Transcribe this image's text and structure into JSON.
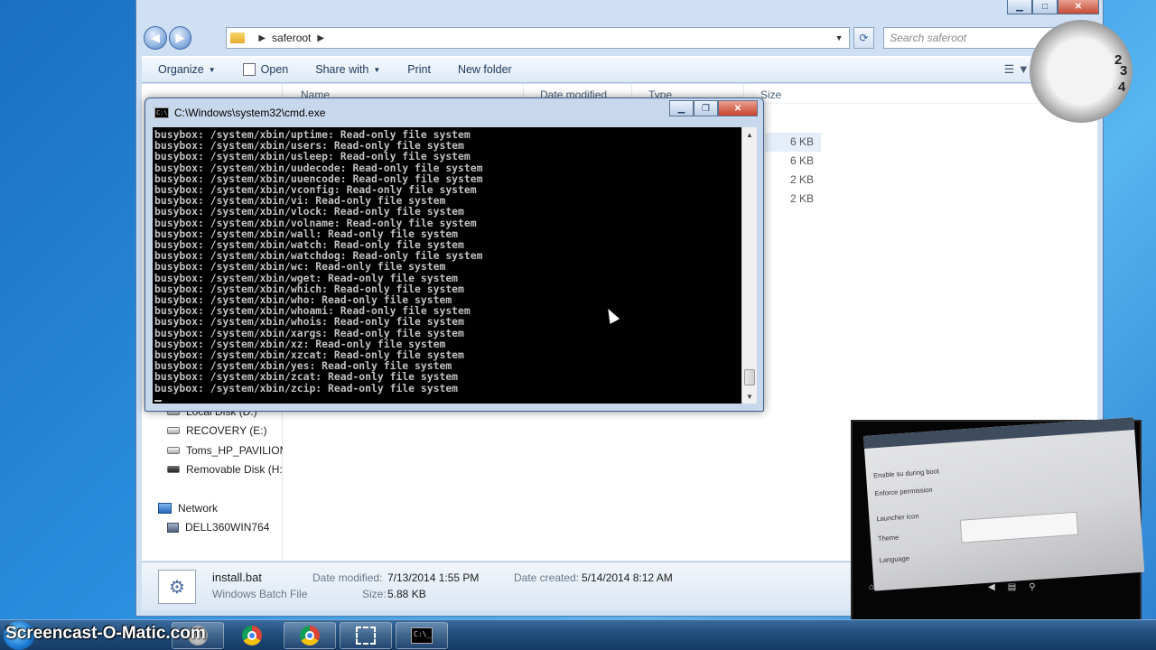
{
  "explorer": {
    "breadcrumb": [
      "saferoot"
    ],
    "search_placeholder": "Search saferoot",
    "toolbar": {
      "organize": "Organize",
      "open": "Open",
      "share_with": "Share with",
      "print": "Print",
      "new_folder": "New folder"
    },
    "columns": {
      "name": "Name",
      "date_modified": "Date modified",
      "type": "Type",
      "size": "Size"
    },
    "file_sizes": [
      "6 KB",
      "6 KB",
      "2 KB",
      "2 KB"
    ],
    "nav_tree": [
      {
        "label": "Local Disk (D:)",
        "icon": "drive-icon"
      },
      {
        "label": "RECOVERY (E:)",
        "icon": "drive-icon"
      },
      {
        "label": "Toms_HP_PAVILION",
        "icon": "drive-icon"
      },
      {
        "label": "Removable Disk (H:)",
        "icon": "removable-disk-icon"
      }
    ],
    "network": {
      "label": "Network",
      "computer": "DELL360WIN764"
    },
    "details": {
      "filename": "install.bat",
      "filetype": "Windows Batch File",
      "date_modified_label": "Date modified:",
      "date_modified": "7/13/2014 1:55 PM",
      "size_label": "Size:",
      "size": "5.88 KB",
      "date_created_label": "Date created:",
      "date_created": "5/14/2014 8:12 AM"
    }
  },
  "cmd": {
    "title": "C:\\Windows\\system32\\cmd.exe",
    "output": "busybox: /system/xbin/uptime: Read-only file system\nbusybox: /system/xbin/users: Read-only file system\nbusybox: /system/xbin/usleep: Read-only file system\nbusybox: /system/xbin/uudecode: Read-only file system\nbusybox: /system/xbin/uuencode: Read-only file system\nbusybox: /system/xbin/vconfig: Read-only file system\nbusybox: /system/xbin/vi: Read-only file system\nbusybox: /system/xbin/vlock: Read-only file system\nbusybox: /system/xbin/volname: Read-only file system\nbusybox: /system/xbin/wall: Read-only file system\nbusybox: /system/xbin/watch: Read-only file system\nbusybox: /system/xbin/watchdog: Read-only file system\nbusybox: /system/xbin/wc: Read-only file system\nbusybox: /system/xbin/wget: Read-only file system\nbusybox: /system/xbin/which: Read-only file system\nbusybox: /system/xbin/who: Read-only file system\nbusybox: /system/xbin/whoami: Read-only file system\nbusybox: /system/xbin/whois: Read-only file system\nbusybox: /system/xbin/xargs: Read-only file system\nbusybox: /system/xbin/xz: Read-only file system\nbusybox: /system/xbin/xzcat: Read-only file system\nbusybox: /system/xbin/yes: Read-only file system\nbusybox: /system/xbin/zcat: Read-only file system\nbusybox: /system/xbin/zcip: Read-only file system"
  },
  "clock_numbers": [
    "2",
    "3",
    "4"
  ],
  "tablet": {
    "rows": [
      "Enable su during boot",
      "Enforce permission",
      "Launcher icon",
      "Theme",
      "Language"
    ]
  },
  "watermark": "Screencast-O-Matic.com",
  "colors": {
    "console_bg": "#000000",
    "console_fg": "#c0c0c0",
    "taskbar": "#1f4b7a"
  }
}
